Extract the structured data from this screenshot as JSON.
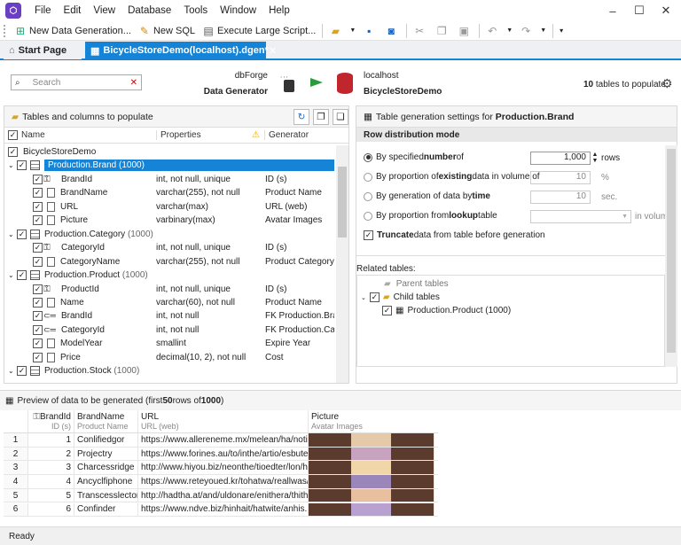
{
  "menu": [
    "File",
    "Edit",
    "View",
    "Database",
    "Tools",
    "Window",
    "Help"
  ],
  "toolbar": {
    "new_data_gen": "New Data Generation...",
    "new_sql": "New SQL",
    "exec_script": "Execute Large Script..."
  },
  "tabs": {
    "start": "Start Page",
    "doc": "BicycleStoreDemo(localhost).dgen*"
  },
  "header": {
    "product_top": "dbForge",
    "product_bottom": "Data Generator",
    "server": "localhost",
    "database": "BicycleStoreDemo",
    "count": "10",
    "count_suffix": "tables to populate"
  },
  "search": {
    "placeholder": "Search"
  },
  "left": {
    "title": "Tables and columns to populate",
    "col_name": "Name",
    "col_props": "Properties",
    "col_gen": "Generator"
  },
  "tree": [
    {
      "kind": "db",
      "name": "BicycleStoreDemo",
      "props": "",
      "gen": ""
    },
    {
      "kind": "table",
      "name": "Production.Brand (1000)",
      "props": "",
      "gen": "",
      "selected": true
    },
    {
      "kind": "pk",
      "name": "BrandId",
      "props": "int, not null, unique",
      "gen": "ID (s)"
    },
    {
      "kind": "col",
      "name": "BrandName",
      "props": "varchar(255), not null",
      "gen": "Product Name"
    },
    {
      "kind": "col",
      "name": "URL",
      "props": "varchar(max)",
      "gen": "URL (web)"
    },
    {
      "kind": "col",
      "name": "Picture",
      "props": "varbinary(max)",
      "gen": "Avatar Images"
    },
    {
      "kind": "table",
      "name": "Production.Category",
      "count": "(1000)",
      "props": "",
      "gen": ""
    },
    {
      "kind": "pk",
      "name": "CategoryId",
      "props": "int, not null, unique",
      "gen": "ID (s)"
    },
    {
      "kind": "col",
      "name": "CategoryName",
      "props": "varchar(255), not null",
      "gen": "Product Category"
    },
    {
      "kind": "table",
      "name": "Production.Product",
      "count": "(1000)",
      "props": "",
      "gen": ""
    },
    {
      "kind": "pk",
      "name": "ProductId",
      "props": "int, not null, unique",
      "gen": "ID (s)"
    },
    {
      "kind": "col",
      "name": "Name",
      "props": "varchar(60), not null",
      "gen": "Product Name"
    },
    {
      "kind": "fk",
      "name": "BrandId",
      "props": "int, not null",
      "gen": "FK Production.Bra..."
    },
    {
      "kind": "fk",
      "name": "CategoryId",
      "props": "int, not null",
      "gen": "FK Production.Cat..."
    },
    {
      "kind": "col",
      "name": "ModelYear",
      "props": "smallint",
      "gen": "Expire Year"
    },
    {
      "kind": "col",
      "name": "Price",
      "props": "decimal(10, 2), not null",
      "gen": "Cost"
    },
    {
      "kind": "table",
      "name": "Production.Stock",
      "count": "(1000)",
      "props": "",
      "gen": ""
    }
  ],
  "right": {
    "title_prefix": "Table generation settings for",
    "title_table": "Production.Brand",
    "section": "Row distribution mode",
    "opt1_a": "By specified ",
    "opt1_b": "number",
    "opt1_c": " of",
    "opt1_val": "1,000",
    "opt1_unit": "rows",
    "opt2_a": "By proportion of ",
    "opt2_b": "existing",
    "opt2_c": " data in volume of",
    "opt2_val": "10",
    "opt2_unit": "%",
    "opt3_a": "By generation of data by ",
    "opt3_b": "time",
    "opt3_val": "10",
    "opt3_unit": "sec.",
    "opt4_a": "By proportion from ",
    "opt4_b": "lookup",
    "opt4_c": " table",
    "opt4_unit": "in volume",
    "trunc_a": "Truncate",
    "trunc_b": " data from table before generation",
    "related": "Related tables:",
    "parent": "Parent tables",
    "child": "Child tables",
    "child_item": "Production.Product (1000)"
  },
  "preview": {
    "title_a": "Preview of data to be generated (first ",
    "title_b": "50",
    "title_c": " rows of ",
    "title_d": "1000",
    "title_e": ")",
    "cols": [
      {
        "name": "BrandId",
        "sub": "ID (s)"
      },
      {
        "name": "BrandName",
        "sub": "Product Name"
      },
      {
        "name": "URL",
        "sub": "URL (web)"
      },
      {
        "name": "Picture",
        "sub": "Avatar Images"
      }
    ],
    "rows": [
      [
        "1",
        "1",
        "Conlifiedgor",
        "https://www.allereneme.mx/melean/ha/notion...."
      ],
      [
        "2",
        "2",
        "Projectry",
        "https://www.forines.au/to/inthe/artio/esbuterte..."
      ],
      [
        "3",
        "3",
        "Charcessridge",
        "http://www.hiyou.biz/neonthe/tioedter/lon/hin..."
      ],
      [
        "4",
        "4",
        "Ancyclfiphone",
        "https://www.reteyoued.kr/tohatwa/reallwas/th..."
      ],
      [
        "5",
        "5",
        "Transcesslector",
        "http://hadtha.at/and/uldonare/enithera/thithe...."
      ],
      [
        "6",
        "6",
        "Confinder",
        "https://www.ndve.biz/hinhait/hatwite/anhis.php"
      ]
    ]
  },
  "status": "Ready"
}
